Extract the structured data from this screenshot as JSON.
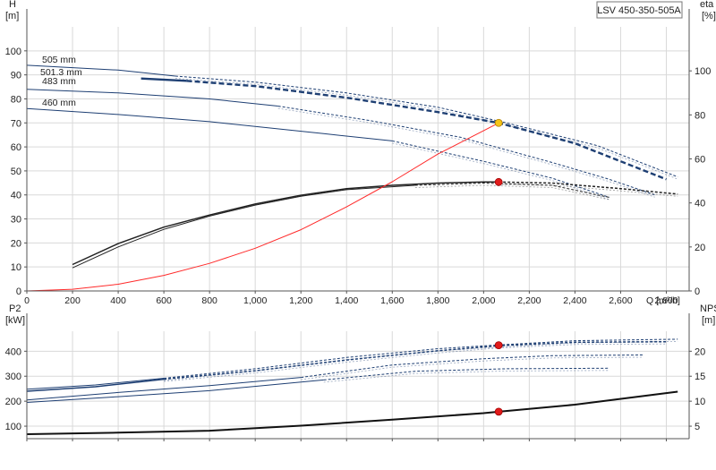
{
  "title": "LSV 450-350-505A",
  "chart_data": [
    {
      "type": "line",
      "xlabel": "Q [m³/h]",
      "ylabel": "H\n[m]",
      "y2label": "eta\n[%]",
      "xlim": [
        0,
        2900
      ],
      "ylim": [
        0,
        110
      ],
      "y2lim": [
        0,
        120
      ],
      "xticks": [
        0,
        200,
        400,
        600,
        800,
        1000,
        1200,
        1400,
        1600,
        1800,
        2000,
        2200,
        2400,
        2600,
        2800
      ],
      "xtick_labels": [
        "0",
        "200",
        "400",
        "600",
        "800",
        "1,000",
        "1,200",
        "1,400",
        "1,600",
        "1,800",
        "2,000",
        "2,200",
        "2,400",
        "2,600",
        "2,800"
      ],
      "yticks": [
        0,
        10,
        20,
        30,
        40,
        50,
        60,
        70,
        80,
        90,
        100
      ],
      "y2ticks": [
        0,
        20,
        40,
        60,
        80,
        100
      ],
      "grid": true,
      "series": [
        {
          "name": "505 mm",
          "axis": "left",
          "color": "#1e3f73",
          "width": 1,
          "solid": [
            [
              0,
              94
            ],
            [
              400,
              92
            ],
            [
              650,
              89.5
            ]
          ],
          "dashed": [
            [
              650,
              89.5
            ],
            [
              1000,
              87
            ],
            [
              1400,
              82.5
            ],
            [
              1800,
              76.5
            ],
            [
              2100,
              70
            ],
            [
              2500,
              60.5
            ],
            [
              2850,
              47.5
            ]
          ]
        },
        {
          "name": "501.3 mm",
          "axis": "left",
          "color": "#1e3f73",
          "width": 2.4,
          "selected": true,
          "solid": [
            [
              500,
              88.5
            ],
            [
              700,
              87.5
            ]
          ],
          "dashed": [
            [
              700,
              87.5
            ],
            [
              1000,
              85.3
            ],
            [
              1400,
              80.5
            ],
            [
              1800,
              74.5
            ],
            [
              2066,
              70
            ],
            [
              2400,
              61.5
            ],
            [
              2800,
              46.5
            ]
          ]
        },
        {
          "name": "483 mm",
          "axis": "left",
          "color": "#1e3f73",
          "width": 1,
          "solid": [
            [
              0,
              84
            ],
            [
              400,
              82.5
            ],
            [
              800,
              80
            ],
            [
              1100,
              77
            ]
          ],
          "dashed": [
            [
              1100,
              77
            ],
            [
              1500,
              71
            ],
            [
              1900,
              64
            ],
            [
              2300,
              53.5
            ],
            [
              2550,
              46.5
            ],
            [
              2750,
              40
            ]
          ]
        },
        {
          "name": "460 mm",
          "axis": "left",
          "color": "#1e3f73",
          "width": 1,
          "solid": [
            [
              0,
              76
            ],
            [
              400,
              73.5
            ],
            [
              800,
              70.5
            ],
            [
              1300,
              65.5
            ],
            [
              1600,
              62.5
            ]
          ],
          "dashed": [
            [
              1600,
              62.5
            ],
            [
              2000,
              54
            ],
            [
              2300,
              47
            ],
            [
              2550,
              39
            ]
          ]
        },
        {
          "name": "",
          "axis": "right",
          "color": "#222222",
          "width": 1.5,
          "solid": [
            [
              200,
              12
            ],
            [
              400,
              21.5
            ],
            [
              600,
              29
            ],
            [
              800,
              34.5
            ],
            [
              1000,
              39.5
            ],
            [
              1200,
              43.5
            ],
            [
              1400,
              46.5
            ],
            [
              1600,
              48
            ],
            [
              1800,
              49
            ],
            [
              2000,
              49.5
            ],
            [
              2066,
              49.5
            ]
          ],
          "dashed": [
            [
              2066,
              49.5
            ],
            [
              2300,
              49
            ],
            [
              2600,
              46.5
            ],
            [
              2850,
              44
            ]
          ]
        },
        {
          "name": "",
          "axis": "right",
          "color": "#222222",
          "width": 1,
          "solid": [
            [
              200,
              10.5
            ],
            [
              400,
              20
            ],
            [
              600,
              28
            ],
            [
              800,
              34
            ],
            [
              1000,
              39
            ],
            [
              1200,
              43
            ],
            [
              1400,
              46
            ],
            [
              1700,
              48
            ]
          ],
          "dashed": [
            [
              1700,
              48
            ],
            [
              2000,
              49
            ],
            [
              2300,
              48
            ],
            [
              2550,
              42.5
            ]
          ]
        },
        {
          "name": "",
          "axis": "left",
          "color": "#ff2a2a",
          "width": 1,
          "note": "system curve",
          "solid": [
            [
              0,
              0
            ],
            [
              200,
              0.7
            ],
            [
              400,
              2.8
            ],
            [
              600,
              6.5
            ],
            [
              800,
              11.5
            ],
            [
              1000,
              17.8
            ],
            [
              1200,
              25.5
            ],
            [
              1400,
              35
            ],
            [
              1600,
              45.5
            ],
            [
              1800,
              57
            ],
            [
              2066,
              70
            ]
          ]
        }
      ],
      "markers": [
        {
          "axis": "left",
          "x": 2066,
          "y": 70,
          "color": "#f5c518"
        },
        {
          "axis": "right",
          "x": 2066,
          "y": 49.5,
          "color": "#e11b1b"
        }
      ],
      "labels": [
        {
          "series": "505 mm",
          "text": "505 mm"
        },
        {
          "series": "501.3 mm",
          "text": "501.3 mm"
        },
        {
          "series": "483 mm",
          "text": "483 mm"
        },
        {
          "series": "460 mm",
          "text": "460 mm"
        }
      ]
    },
    {
      "type": "line",
      "ylabel": "P2\n[kW]",
      "y2label": "NPSH\n[m]",
      "xlim": [
        0,
        2900
      ],
      "ylim": [
        50,
        480
      ],
      "y2lim": [
        2.5,
        24
      ],
      "yticks": [
        100,
        200,
        300,
        400
      ],
      "y2ticks": [
        5,
        10,
        15,
        20
      ],
      "grid": true,
      "series": [
        {
          "name": "505 mm",
          "axis": "left",
          "color": "#1e3f73",
          "width": 1,
          "solid": [
            [
              0,
              248
            ],
            [
              300,
              265
            ],
            [
              600,
              292
            ]
          ],
          "dashed": [
            [
              600,
              292
            ],
            [
              1000,
              330
            ],
            [
              1400,
              375
            ],
            [
              1800,
              410
            ],
            [
              2066,
              425
            ],
            [
              2400,
              442
            ],
            [
              2850,
              448
            ]
          ]
        },
        {
          "name": "501.3 mm",
          "axis": "left",
          "color": "#1e3f73",
          "width": 1.5,
          "solid": [
            [
              0,
              240
            ],
            [
              300,
              258
            ],
            [
              600,
              288
            ]
          ],
          "dashed": [
            [
              600,
              288
            ],
            [
              1000,
              322
            ],
            [
              1400,
              365
            ],
            [
              1800,
              402
            ],
            [
              2066,
              422
            ],
            [
              2400,
              436
            ],
            [
              2800,
              438
            ]
          ]
        },
        {
          "name": "483 mm",
          "axis": "left",
          "color": "#1e3f73",
          "width": 1,
          "solid": [
            [
              0,
              205
            ],
            [
              400,
              235
            ],
            [
              800,
              262
            ],
            [
              1200,
              295
            ]
          ],
          "dashed": [
            [
              1200,
              295
            ],
            [
              1600,
              345
            ],
            [
              2000,
              370
            ],
            [
              2300,
              382
            ],
            [
              2700,
              385
            ]
          ]
        },
        {
          "name": "460 mm",
          "axis": "left",
          "color": "#1e3f73",
          "width": 1,
          "solid": [
            [
              0,
              195
            ],
            [
              400,
              218
            ],
            [
              800,
              242
            ],
            [
              1300,
              285
            ]
          ],
          "dashed": [
            [
              1300,
              285
            ],
            [
              1700,
              320
            ],
            [
              2100,
              330
            ],
            [
              2550,
              332
            ]
          ]
        },
        {
          "name": "",
          "axis": "right",
          "color": "#111111",
          "width": 2,
          "solid": [
            [
              0,
              3.4
            ],
            [
              400,
              3.7
            ],
            [
              800,
              4.1
            ],
            [
              1200,
              5.1
            ],
            [
              1600,
              6.3
            ],
            [
              2000,
              7.6
            ],
            [
              2066,
              7.9
            ],
            [
              2400,
              9.3
            ],
            [
              2850,
              11.9
            ]
          ]
        }
      ],
      "markers": [
        {
          "axis": "left",
          "x": 2066,
          "y": 424,
          "color": "#e11b1b"
        },
        {
          "axis": "right",
          "x": 2066,
          "y": 7.9,
          "color": "#e11b1b"
        }
      ]
    }
  ]
}
